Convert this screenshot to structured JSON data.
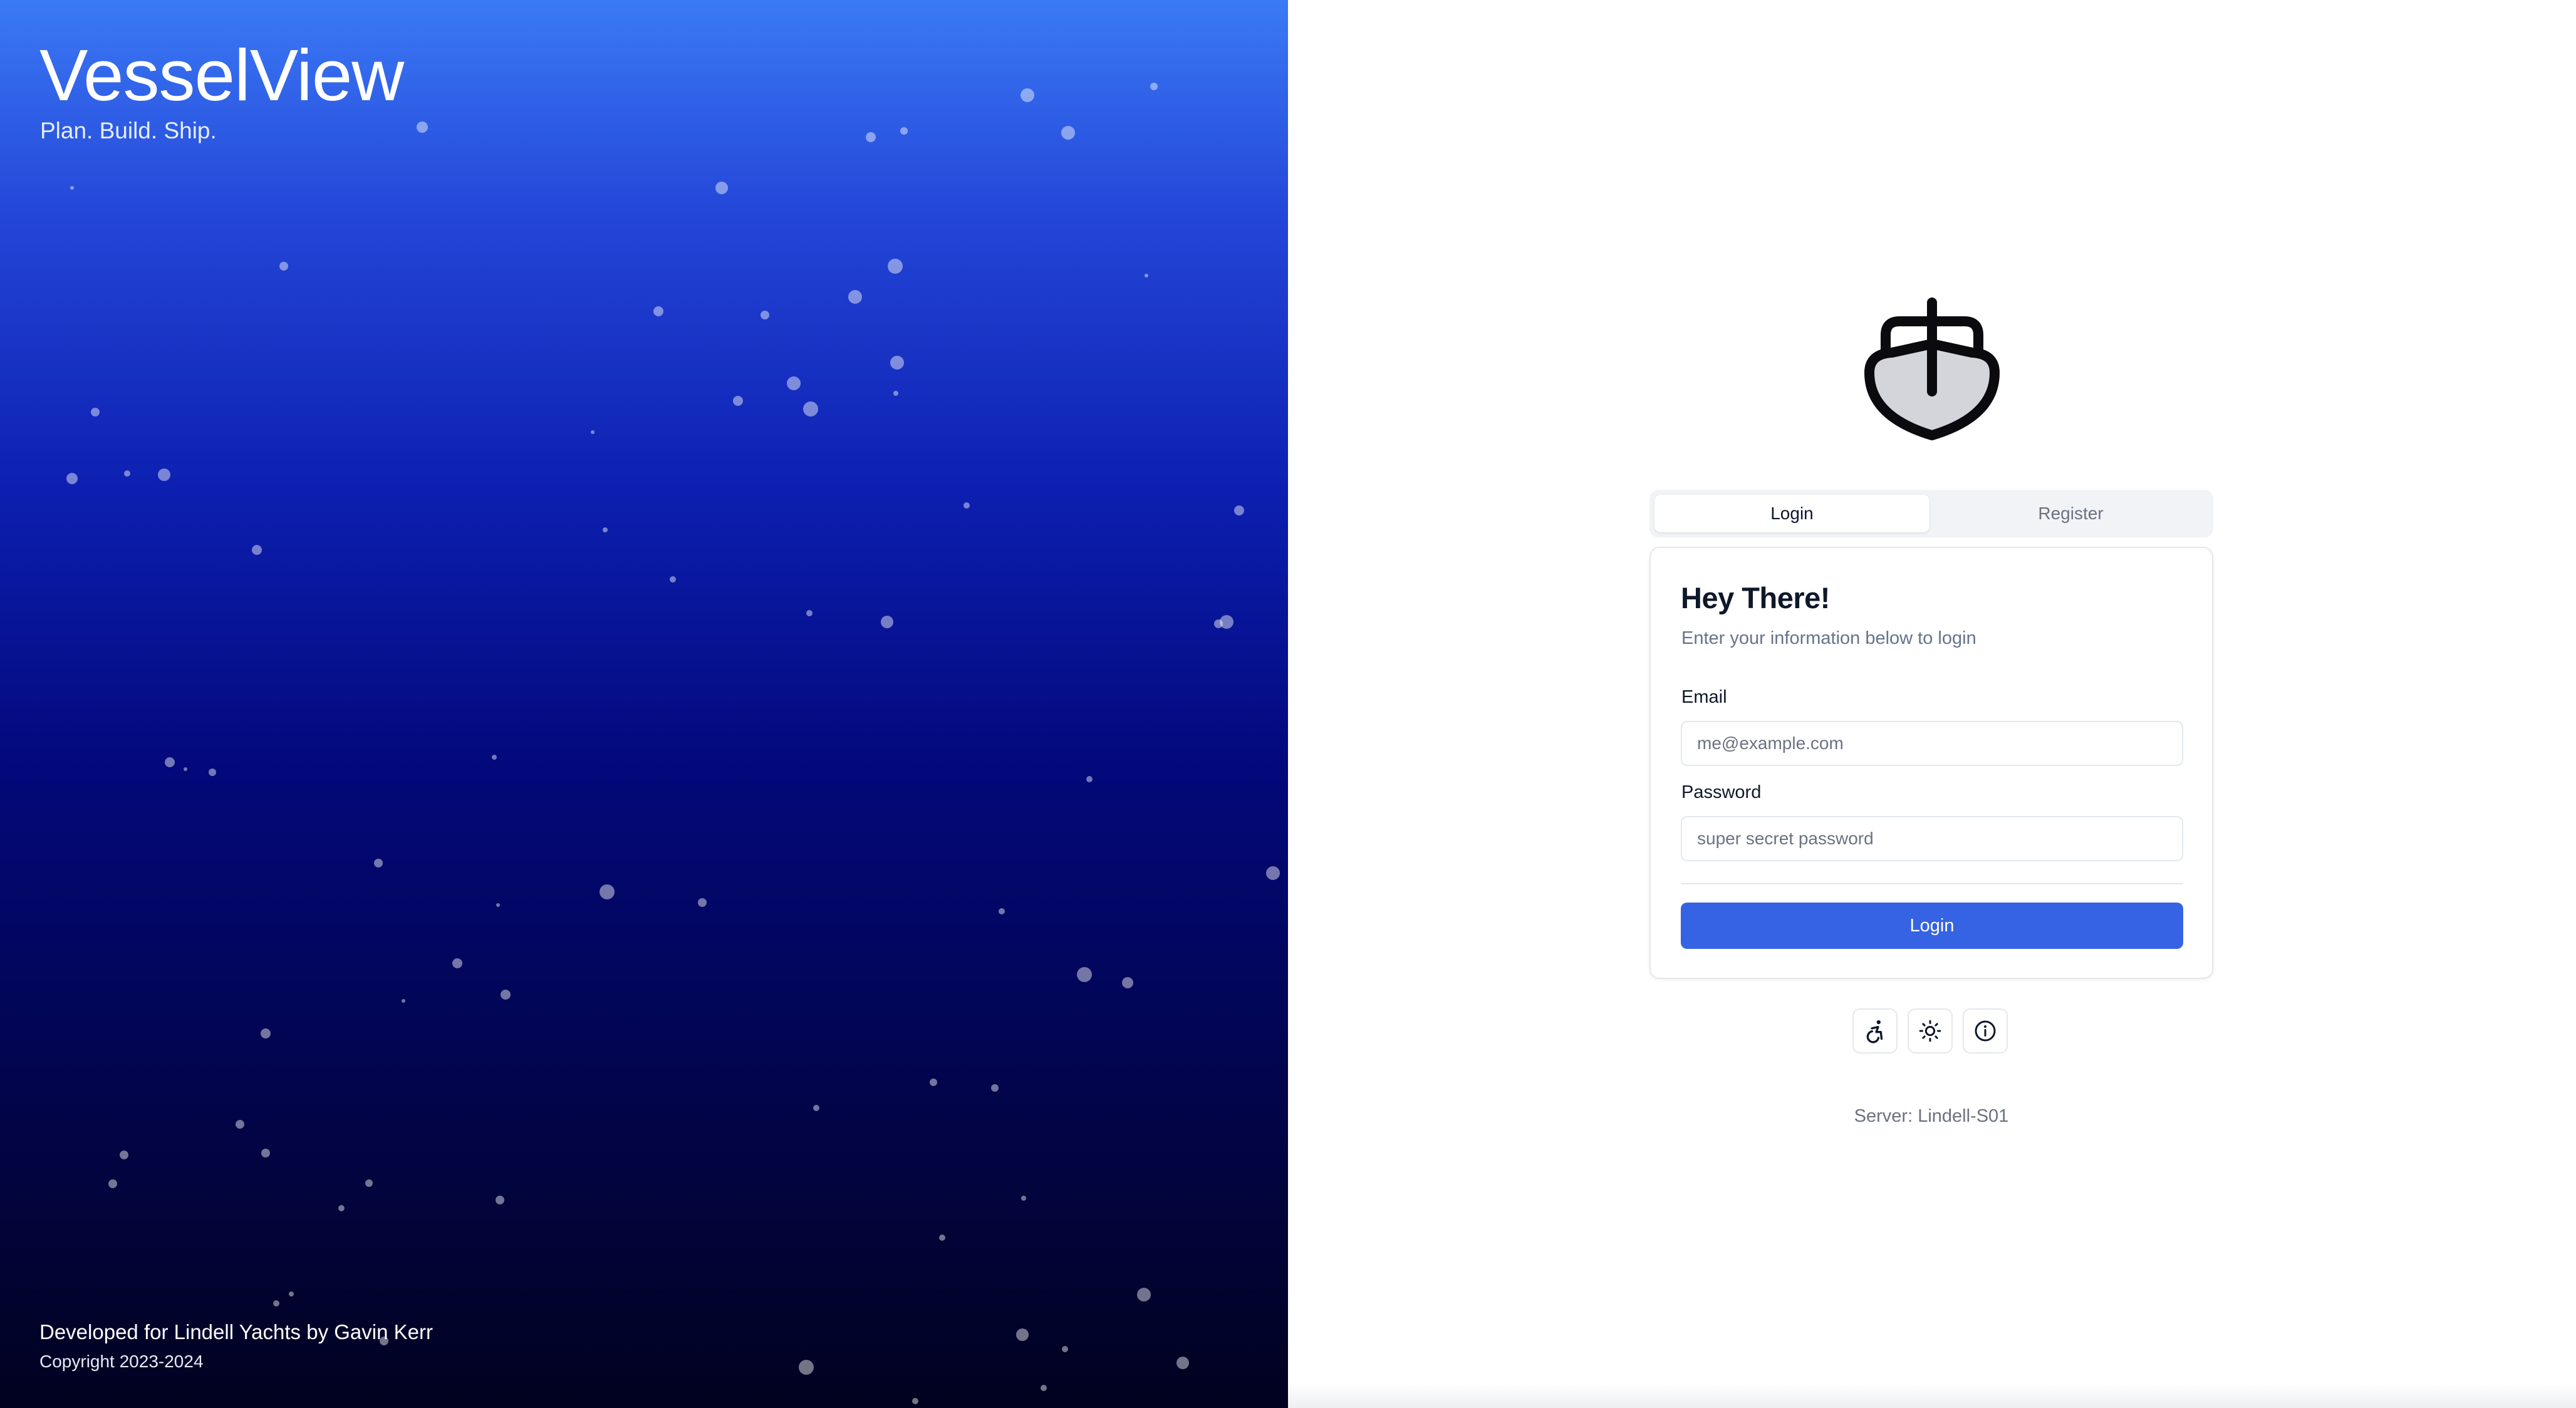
{
  "brand": {
    "title": "VesselView",
    "tagline": "Plan. Build. Ship."
  },
  "hero_footer": {
    "credit": "Developed for Lindell Yachts by Gavin Kerr",
    "copyright": "Copyright 2023-2024"
  },
  "logo": {
    "icon": "ship-icon"
  },
  "tabs": [
    {
      "label": "Login",
      "active": true
    },
    {
      "label": "Register",
      "active": false
    }
  ],
  "login_card": {
    "title": "Hey There!",
    "subtitle": "Enter your information below to login",
    "email": {
      "label": "Email",
      "placeholder": "me@example.com",
      "value": ""
    },
    "password": {
      "label": "Password",
      "placeholder": "super secret password",
      "value": ""
    },
    "submit_label": "Login"
  },
  "toolbar": {
    "buttons": [
      {
        "icon": "accessibility-icon"
      },
      {
        "icon": "sun-icon"
      },
      {
        "icon": "info-icon"
      }
    ]
  },
  "server": {
    "text": "Server: Lindell-S01"
  },
  "colors": {
    "accent": "#3563e3",
    "hero_top": "#3b7af5",
    "hero_bottom": "#01021f"
  }
}
